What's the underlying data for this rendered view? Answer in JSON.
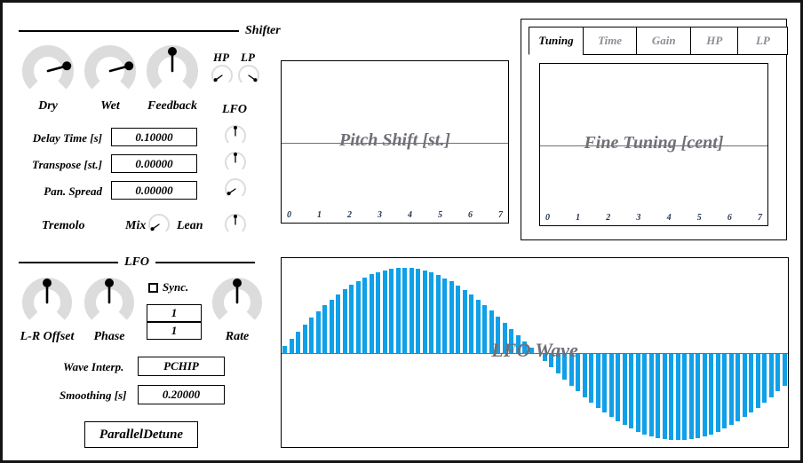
{
  "window": {
    "title": "ParallelDetune"
  },
  "shifter": {
    "section_label": "Shifter",
    "knobs": [
      {
        "name": "dry",
        "label": "Dry",
        "angle_deg": 75
      },
      {
        "name": "wet",
        "label": "Wet",
        "angle_deg": 75
      },
      {
        "name": "feedback",
        "label": "Feedback",
        "angle_deg": 0
      }
    ],
    "filters": [
      {
        "name": "hp",
        "label": "HP",
        "angle_deg": -125
      },
      {
        "name": "lp",
        "label": "LP",
        "angle_deg": 125
      }
    ],
    "lfo_column_label": "LFO",
    "lfo_mod_knobs": [
      {
        "name": "delay-time-lfo",
        "angle_deg": 0
      },
      {
        "name": "transpose-lfo",
        "angle_deg": 0
      },
      {
        "name": "pan-spread-lfo",
        "angle_deg": -125
      }
    ],
    "fields": [
      {
        "name": "delay-time",
        "label": "Delay Time [s]",
        "value": "0.10000"
      },
      {
        "name": "transpose",
        "label": "Transpose [st.]",
        "value": "0.00000"
      },
      {
        "name": "pan-spread",
        "label": "Pan. Spread",
        "value": "0.00000"
      }
    ],
    "tremolo": {
      "label": "Tremolo",
      "mix_label": "Mix",
      "mix_angle_deg": -125,
      "lean_label": "Lean",
      "lean_angle_deg": 0
    }
  },
  "lfo": {
    "section_label": "LFO",
    "knobs": [
      {
        "name": "lr-offset",
        "label": "L-R Offset",
        "angle_deg": 0
      },
      {
        "name": "phase",
        "label": "Phase",
        "angle_deg": 0
      },
      {
        "name": "rate",
        "label": "Rate",
        "angle_deg": 0
      }
    ],
    "sync": {
      "label": "Sync.",
      "checked": false
    },
    "sync_numerator": "1",
    "sync_denominator": "1",
    "wave_interp": {
      "label": "Wave Interp.",
      "value": "PCHIP"
    },
    "smoothing": {
      "label": "Smoothing [s]",
      "value": "0.20000"
    },
    "preset_button": "ParallelDetune"
  },
  "plots": {
    "pitch_shift": {
      "title": "Pitch Shift [st.]",
      "ticks": [
        "0",
        "1",
        "2",
        "3",
        "4",
        "5",
        "6",
        "7"
      ]
    },
    "fine_tuning": {
      "title": "Fine Tuning [cent]",
      "ticks": [
        "0",
        "1",
        "2",
        "3",
        "4",
        "5",
        "6",
        "7"
      ]
    },
    "lfo_wave": {
      "title": "LFO Wave"
    }
  },
  "tabs": [
    {
      "name": "tuning",
      "label": "Tuning",
      "active": true
    },
    {
      "name": "time",
      "label": "Time",
      "active": false
    },
    {
      "name": "gain",
      "label": "Gain",
      "active": false
    },
    {
      "name": "hp",
      "label": "HP",
      "active": false
    },
    {
      "name": "lp",
      "label": "LP",
      "active": false
    }
  ],
  "colors": {
    "wave_blue": "#10a0e8",
    "knob_track": "#dcdcdc",
    "plot_text": "#6f6f78",
    "tick_text": "#23354f"
  },
  "chart_data": {
    "type": "bar",
    "title": "LFO Wave",
    "xlabel": "",
    "ylabel": "",
    "n_bars": 76,
    "waveform": "sine",
    "cycles": 1,
    "ylim": [
      -1,
      1
    ],
    "grid": false,
    "legend": null,
    "values": [
      0.082,
      0.165,
      0.245,
      0.323,
      0.399,
      0.471,
      0.54,
      0.605,
      0.665,
      0.72,
      0.77,
      0.815,
      0.854,
      0.887,
      0.914,
      0.935,
      0.95,
      0.959,
      0.961,
      0.957,
      0.947,
      0.93,
      0.908,
      0.879,
      0.845,
      0.806,
      0.761,
      0.712,
      0.659,
      0.601,
      0.541,
      0.477,
      0.411,
      0.343,
      0.273,
      0.202,
      0.131,
      0.059,
      -0.014,
      -0.086,
      -0.158,
      -0.229,
      -0.299,
      -0.367,
      -0.433,
      -0.497,
      -0.558,
      -0.616,
      -0.671,
      -0.722,
      -0.77,
      -0.813,
      -0.852,
      -0.886,
      -0.916,
      -0.94,
      -0.959,
      -0.973,
      -0.981,
      -0.984,
      -0.981,
      -0.973,
      -0.959,
      -0.94,
      -0.916,
      -0.886,
      -0.852,
      -0.813,
      -0.77,
      -0.722,
      -0.671,
      -0.616,
      -0.558,
      -0.497,
      -0.433,
      -0.367
    ]
  }
}
